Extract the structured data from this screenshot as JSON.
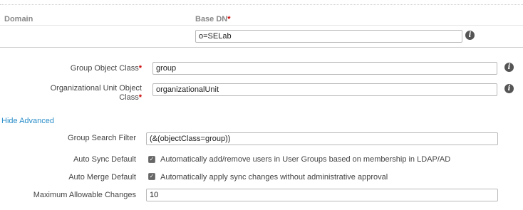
{
  "header": {
    "domain_label": "Domain",
    "basedn_label": "Base DN",
    "required_mark": "*"
  },
  "base_dn": {
    "value": "o=SELab"
  },
  "group_object_class": {
    "label": "Group Object Class",
    "value": "group"
  },
  "ou_object_class": {
    "label_line1": "Organizational Unit Object",
    "label_line2": "Class",
    "value": "organizationalUnit"
  },
  "advanced": {
    "toggle_label": "Hide Advanced",
    "group_search_filter": {
      "label": "Group Search Filter",
      "value": "(&(objectClass=group))"
    },
    "auto_sync": {
      "label": "Auto Sync Default",
      "checked": true,
      "text": "Automatically add/remove users in User Groups based on membership in LDAP/AD"
    },
    "auto_merge": {
      "label": "Auto Merge Default",
      "checked": true,
      "text": "Automatically apply sync changes without administrative approval"
    },
    "max_changes": {
      "label": "Maximum Allowable Changes",
      "value": "10"
    }
  },
  "icons": {
    "info": "info-icon",
    "check": "checkmark-icon"
  }
}
